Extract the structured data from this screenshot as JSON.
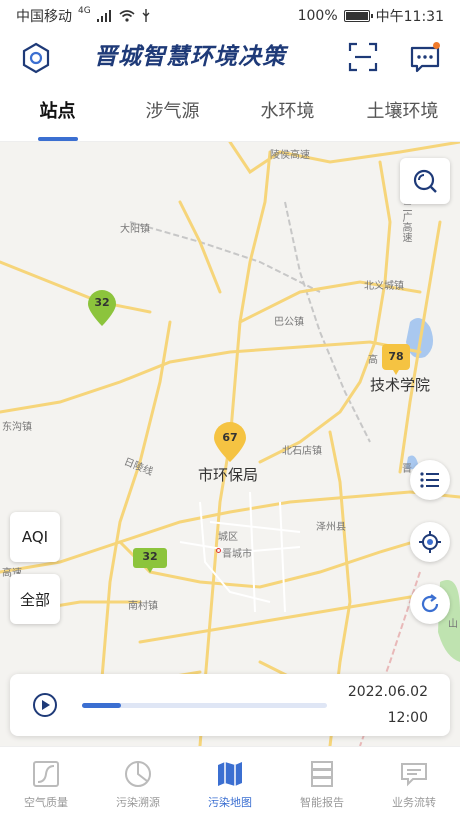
{
  "status_bar": {
    "carrier": "中国移动",
    "network": "4G",
    "battery": "100%",
    "time": "中午11:31"
  },
  "header": {
    "title": "晋城智慧环境决策"
  },
  "tabs": [
    {
      "label": "站点",
      "active": true
    },
    {
      "label": "涉气源",
      "active": false
    },
    {
      "label": "水环境",
      "active": false
    },
    {
      "label": "土壤环境",
      "active": false
    }
  ],
  "map": {
    "labels": {
      "lingchuan": "陵侯高速",
      "dayang": "大阳镇",
      "beiyi": "北义城镇",
      "bagong": "巴公镇",
      "gaoping": "高",
      "jishu": "技术学院",
      "dongkou": "东沟镇",
      "beishidian": "北石店镇",
      "shihuanbao": "市环保局",
      "rihou": "日陵线",
      "zexian": "泽州县",
      "chengqu": "城区",
      "jincheng": "晋城市",
      "nancun": "南村镇",
      "gaosu": "高速",
      "erguang": "二广高速",
      "jin": "晋",
      "shan": "山"
    },
    "markers": [
      {
        "value": "32",
        "color": "#8cc43c"
      },
      {
        "value": "78",
        "color": "#f5c342"
      },
      {
        "value": "67",
        "color": "#f5c342"
      },
      {
        "value": "32",
        "color": "#8cc43c"
      }
    ],
    "aqi_label": "AQI",
    "all_label": "全部"
  },
  "player": {
    "date": "2022.06.02",
    "time": "12:00",
    "progress": 0.16
  },
  "bottom_nav": [
    {
      "label": "空气质量",
      "icon": "air-quality-icon",
      "active": false
    },
    {
      "label": "污染溯源",
      "icon": "pollution-trace-icon",
      "active": false
    },
    {
      "label": "污染地图",
      "icon": "map-icon",
      "active": true
    },
    {
      "label": "智能报告",
      "icon": "report-icon",
      "active": false
    },
    {
      "label": "业务流转",
      "icon": "workflow-icon",
      "active": false
    }
  ],
  "colors": {
    "accent": "#3b6fd1",
    "title": "#1e3a78",
    "good": "#8cc43c",
    "moderate": "#f5c342"
  }
}
